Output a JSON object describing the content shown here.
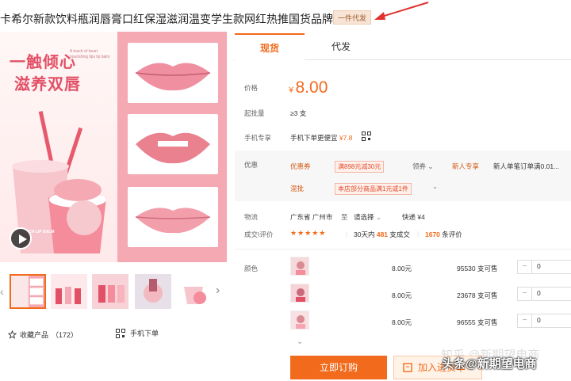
{
  "product": {
    "title": "卡希尔新款饮料瓶润唇膏口红保湿滋润温变学生款网红热推国货品牌",
    "tag": "一件代发"
  },
  "gallery": {
    "headline1": "一触倾心",
    "headline2": "滋养双唇",
    "subtext": "A touch of heart nourishing lips lip balm",
    "cup_label": "PEACH LIP BALM",
    "thumb_count": 5
  },
  "actions": {
    "favorite_label": "收藏产品",
    "favorite_count": "（172）",
    "mobile_order_label": "手机下单"
  },
  "tabs": [
    {
      "label": "现货"
    },
    {
      "label": "代发"
    }
  ],
  "price": {
    "label": "价格",
    "currency": "¥",
    "value": "8.00"
  },
  "moq": {
    "label": "起批量",
    "value": "≥3 支"
  },
  "mobile": {
    "label": "手机专享",
    "value": "手机下单更便宜",
    "discount": "¥7.8"
  },
  "promo": {
    "label": "优惠",
    "coupon_label": "优惠券",
    "coupon": "满898元减30元",
    "claim": "领券",
    "new_user_label": "新人专享",
    "new_user_text": "新人单笔订单满0.01...",
    "mixed_label": "混批",
    "mixed_text": "本店部分商品满1元或1件"
  },
  "logistics": {
    "label": "物流",
    "origin": "广东省 广州市",
    "to": "至",
    "dest": "请选择",
    "express": "快递 ¥4"
  },
  "reviews": {
    "label": "成交\\评价",
    "stars": "★★★★★",
    "sold_prefix": "30天内",
    "sold_count": "481",
    "sold_suffix": "支成交",
    "review_count": "1670",
    "review_suffix": "条评价"
  },
  "variants": {
    "label": "颜色",
    "items": [
      {
        "price": "8.00元",
        "stock": "95530 支可售",
        "qty": "0"
      },
      {
        "price": "8.00元",
        "stock": "23678 支可售",
        "qty": "0"
      },
      {
        "price": "8.00元",
        "stock": "96555 支可售",
        "qty": "0"
      }
    ]
  },
  "buttons": {
    "buy": "立即订购",
    "cart": "加入进货单"
  },
  "watermark": {
    "zhihu": "知乎 @新期望电商",
    "toutiao": "头条@新期望电商"
  },
  "colors": {
    "accent": "#f26a1b",
    "pink": "#f4a9b3"
  }
}
